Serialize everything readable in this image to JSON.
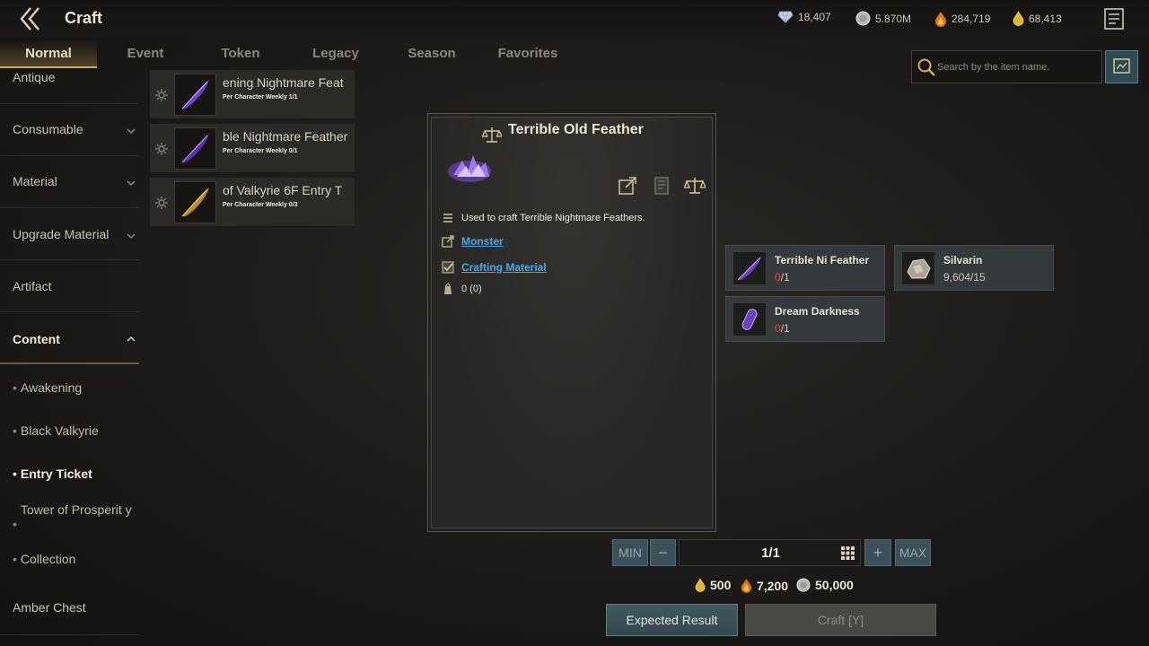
{
  "header": {
    "title": "Craft",
    "back_icon": "double-chevron-left-icon",
    "menu_icon": "list-menu-icon",
    "currencies": [
      {
        "icon": "diamond-icon",
        "value": "18,407"
      },
      {
        "icon": "silver-coin-icon",
        "value": "5.870M"
      },
      {
        "icon": "red-flame-icon",
        "value": "284,719"
      },
      {
        "icon": "gold-drop-icon",
        "value": "68,413"
      }
    ]
  },
  "tabs": [
    {
      "label": "Normal",
      "active": true
    },
    {
      "label": "Event",
      "active": false
    },
    {
      "label": "Token",
      "active": false
    },
    {
      "label": "Legacy",
      "active": false
    },
    {
      "label": "Season",
      "active": false
    },
    {
      "label": "Favorites",
      "active": false
    }
  ],
  "search": {
    "placeholder": "Search by the item name."
  },
  "sidebar": {
    "categories": [
      {
        "label": "Antique"
      },
      {
        "label": "Consumable"
      },
      {
        "label": "Material"
      },
      {
        "label": "Upgrade Material"
      },
      {
        "label": "Artifact"
      },
      {
        "label": "Content"
      },
      {
        "label": "Amber Chest"
      }
    ],
    "subitems": [
      {
        "label": "Awakening"
      },
      {
        "label": "Black Valkyrie"
      },
      {
        "label": "Entry Ticket"
      },
      {
        "label": "Tower of Prosperit y"
      },
      {
        "label": "Collection"
      }
    ]
  },
  "recipes": [
    {
      "name": "ening Nightmare Feat",
      "limit": "Per Character Weekly 1/1"
    },
    {
      "name": "ble Nightmare Feather",
      "limit": "Per Character Weekly 0/1"
    },
    {
      "name": "of Valkyrie 6F Entry T",
      "limit": "Per Character Weekly 0/3"
    }
  ],
  "detail": {
    "title": "Terrible Old Feather",
    "description": "Used to craft Terrible Nightmare Feathers.",
    "source_link": "Monster",
    "type_link": "Crafting Material",
    "owned": "0 (0)"
  },
  "materials": [
    {
      "name": "Terrible Ni Feather",
      "have": "0",
      "need": "/1"
    },
    {
      "name": "Silvarin",
      "have": "9,604",
      "need": "/15"
    },
    {
      "name": "Dream Darkness",
      "have": "0",
      "need": "/1"
    }
  ],
  "quantity": {
    "min_label": "MIN",
    "max_label": "MAX",
    "minus": "−",
    "plus": "+",
    "value": "1/1"
  },
  "costs": [
    {
      "icon": "gold-drop-icon",
      "value": "500"
    },
    {
      "icon": "red-flame-icon",
      "value": "7,200"
    },
    {
      "icon": "silver-coin-icon",
      "value": "50,000"
    }
  ],
  "actions": {
    "expected": "Expected Result",
    "craft": "Craft [Y]"
  },
  "colors": {
    "accent_gold": "#c9a86a",
    "link_blue": "#4aa8e8",
    "lack_red": "#e04a3e",
    "button_teal": "#3b5058"
  }
}
